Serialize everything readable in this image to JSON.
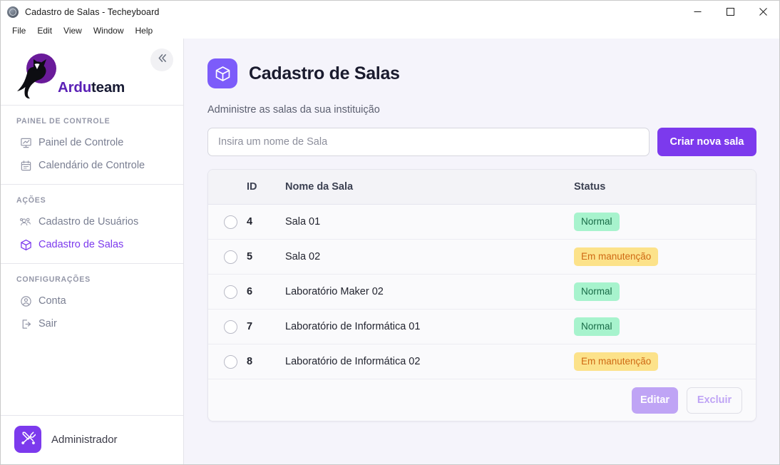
{
  "window": {
    "title": "Cadastro de Salas - Techeyboard",
    "icon": "app-logo-icon",
    "controls": {
      "minimize": "minimize-icon",
      "maximize": "maximize-icon",
      "close": "close-icon"
    }
  },
  "menubar": {
    "items": [
      {
        "label": "File"
      },
      {
        "label": "Edit"
      },
      {
        "label": "View"
      },
      {
        "label": "Window"
      },
      {
        "label": "Help"
      }
    ]
  },
  "sidebar": {
    "brand": {
      "prefix": "Ardu",
      "suffix": "team",
      "logo": "owl-logo-icon"
    },
    "collapse": {
      "icon": "chevrons-left-icon"
    },
    "sections": [
      {
        "label": "PAINEL DE CONTROLE",
        "items": [
          {
            "label": "Painel de Controle",
            "icon": "dashboard-icon",
            "active": false
          },
          {
            "label": "Calendário de Controle",
            "icon": "calendar-icon",
            "active": false
          }
        ]
      },
      {
        "label": "AÇÕES",
        "items": [
          {
            "label": "Cadastro de Usuários",
            "icon": "users-icon",
            "active": false
          },
          {
            "label": "Cadastro de Salas",
            "icon": "box-icon",
            "active": true
          }
        ]
      },
      {
        "label": "CONFIGURAÇÕES",
        "items": [
          {
            "label": "Conta",
            "icon": "account-circle-icon",
            "active": false
          },
          {
            "label": "Sair",
            "icon": "logout-icon",
            "active": false
          }
        ]
      }
    ],
    "user": {
      "name": "Administrador",
      "avatar_icon": "tools-icon"
    }
  },
  "page": {
    "icon": "box-icon",
    "title": "Cadastro de Salas",
    "subtitle": "Administre as salas da sua instituição"
  },
  "form": {
    "input_placeholder": "Insira um nome de Sala",
    "input_value": "",
    "create_label": "Criar nova sala"
  },
  "table": {
    "columns": [
      "",
      "ID",
      "Nome da Sala",
      "Status"
    ],
    "rows": [
      {
        "selected": false,
        "id": "4",
        "name": "Sala 01",
        "status": "Normal",
        "status_kind": "normal"
      },
      {
        "selected": false,
        "id": "5",
        "name": "Sala 02",
        "status": "Em manutenção",
        "status_kind": "maint"
      },
      {
        "selected": false,
        "id": "6",
        "name": "Laboratório Maker 02",
        "status": "Normal",
        "status_kind": "normal"
      },
      {
        "selected": false,
        "id": "7",
        "name": "Laboratório de Informática 01",
        "status": "Normal",
        "status_kind": "normal"
      },
      {
        "selected": false,
        "id": "8",
        "name": "Laboratório de Informática 02",
        "status": "Em manutenção",
        "status_kind": "maint"
      }
    ],
    "footer": {
      "edit_label": "Editar",
      "delete_label": "Excluir"
    }
  },
  "colors": {
    "accent": "#7c3aed",
    "accent_soft": "#bfa4f5",
    "page_icon": "#7c5cfa",
    "brand_purple": "#5b21b6",
    "brand_dark": "#171a33",
    "main_bg": "#f5f4fb",
    "badge_normal_bg": "#a7f3cd",
    "badge_normal_fg": "#186b47",
    "badge_maint_bg": "#fce28a",
    "badge_maint_fg": "#cf6a14"
  }
}
